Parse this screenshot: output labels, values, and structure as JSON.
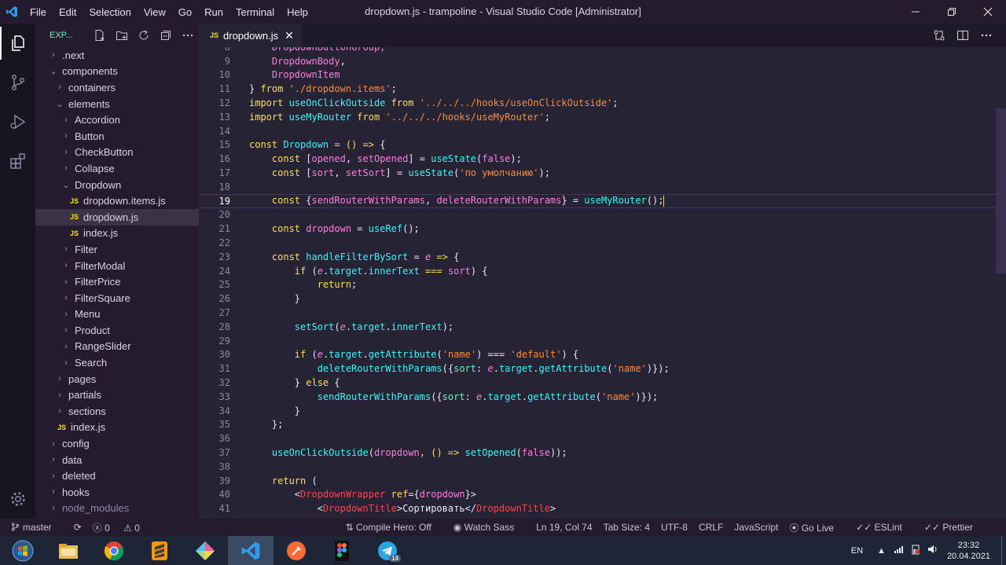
{
  "window": {
    "title": "dropdown.js - trampoline - Visual Studio Code [Administrator]"
  },
  "menu": [
    "File",
    "Edit",
    "Selection",
    "View",
    "Go",
    "Run",
    "Terminal",
    "Help"
  ],
  "sidebar": {
    "header": "EXP...",
    "tree": [
      {
        "label": ".next",
        "depth": 0,
        "type": "folder",
        "open": false
      },
      {
        "label": "components",
        "depth": 0,
        "type": "folder",
        "open": true
      },
      {
        "label": "containers",
        "depth": 1,
        "type": "folder",
        "open": false
      },
      {
        "label": "elements",
        "depth": 1,
        "type": "folder",
        "open": true
      },
      {
        "label": "Accordion",
        "depth": 2,
        "type": "folder",
        "open": false
      },
      {
        "label": "Button",
        "depth": 2,
        "type": "folder",
        "open": false
      },
      {
        "label": "CheckButton",
        "depth": 2,
        "type": "folder",
        "open": false
      },
      {
        "label": "Collapse",
        "depth": 2,
        "type": "folder",
        "open": false
      },
      {
        "label": "Dropdown",
        "depth": 2,
        "type": "folder",
        "open": true
      },
      {
        "label": "dropdown.items.js",
        "depth": 3,
        "type": "js"
      },
      {
        "label": "dropdown.js",
        "depth": 3,
        "type": "js",
        "selected": true
      },
      {
        "label": "index.js",
        "depth": 3,
        "type": "js"
      },
      {
        "label": "Filter",
        "depth": 2,
        "type": "folder",
        "open": false
      },
      {
        "label": "FilterModal",
        "depth": 2,
        "type": "folder",
        "open": false
      },
      {
        "label": "FilterPrice",
        "depth": 2,
        "type": "folder",
        "open": false
      },
      {
        "label": "FilterSquare",
        "depth": 2,
        "type": "folder",
        "open": false
      },
      {
        "label": "Menu",
        "depth": 2,
        "type": "folder",
        "open": false
      },
      {
        "label": "Product",
        "depth": 2,
        "type": "folder",
        "open": false
      },
      {
        "label": "RangeSlider",
        "depth": 2,
        "type": "folder",
        "open": false
      },
      {
        "label": "Search",
        "depth": 2,
        "type": "folder",
        "open": false
      },
      {
        "label": "pages",
        "depth": 1,
        "type": "folder",
        "open": false
      },
      {
        "label": "partials",
        "depth": 1,
        "type": "folder",
        "open": false
      },
      {
        "label": "sections",
        "depth": 1,
        "type": "folder",
        "open": false
      },
      {
        "label": "index.js",
        "depth": 1,
        "type": "js"
      },
      {
        "label": "config",
        "depth": 0,
        "type": "folder",
        "open": false
      },
      {
        "label": "data",
        "depth": 0,
        "type": "folder",
        "open": false
      },
      {
        "label": "deleted",
        "depth": 0,
        "type": "folder",
        "open": false
      },
      {
        "label": "hooks",
        "depth": 0,
        "type": "folder",
        "open": false
      },
      {
        "label": "node_modules",
        "depth": 0,
        "type": "folder",
        "open": false,
        "dim": true
      }
    ]
  },
  "tab": {
    "label": "dropdown.js",
    "icon": "JS"
  },
  "editor": {
    "current_line": 19,
    "lines": [
      {
        "n": "9",
        "t": [
          [
            "    ",
            "b"
          ],
          [
            "DropdownBody",
            "v"
          ],
          [
            ",",
            "b"
          ]
        ]
      },
      {
        "n": "10",
        "t": [
          [
            "    ",
            "b"
          ],
          [
            "DropdownItem",
            "v"
          ]
        ]
      },
      {
        "n": "11",
        "t": [
          [
            "} ",
            "b"
          ],
          [
            "from ",
            "k"
          ],
          [
            "'./dropdown.items'",
            "s"
          ],
          [
            ";",
            "b"
          ]
        ]
      },
      {
        "n": "12",
        "t": [
          [
            "import ",
            "k"
          ],
          [
            "useOnClickOutside ",
            "f"
          ],
          [
            "from ",
            "k"
          ],
          [
            "'../../../hooks/useOnClickOutside'",
            "s"
          ],
          [
            ";",
            "b"
          ]
        ]
      },
      {
        "n": "13",
        "t": [
          [
            "import ",
            "k"
          ],
          [
            "useMyRouter ",
            "f"
          ],
          [
            "from ",
            "k"
          ],
          [
            "'../../../hooks/useMyRouter'",
            "s"
          ],
          [
            ";",
            "b"
          ]
        ]
      },
      {
        "n": "14",
        "t": []
      },
      {
        "n": "15",
        "t": [
          [
            "const ",
            "k"
          ],
          [
            "Dropdown ",
            "f"
          ],
          [
            "= () => ",
            "k"
          ],
          [
            "{",
            "b"
          ]
        ]
      },
      {
        "n": "16",
        "t": [
          [
            "    const ",
            "k"
          ],
          [
            "[",
            "b"
          ],
          [
            "opened",
            "v"
          ],
          [
            ", ",
            "b"
          ],
          [
            "setOpened",
            "v"
          ],
          [
            "] = ",
            "b"
          ],
          [
            "useState",
            "f"
          ],
          [
            "(",
            "b"
          ],
          [
            "false",
            "v"
          ],
          [
            ");",
            "b"
          ]
        ]
      },
      {
        "n": "17",
        "t": [
          [
            "    const ",
            "k"
          ],
          [
            "[",
            "b"
          ],
          [
            "sort",
            "v"
          ],
          [
            ", ",
            "b"
          ],
          [
            "setSort",
            "v"
          ],
          [
            "] = ",
            "b"
          ],
          [
            "useState",
            "f"
          ],
          [
            "(",
            "b"
          ],
          [
            "'по умолчанию'",
            "s"
          ],
          [
            ");",
            "b"
          ]
        ]
      },
      {
        "n": "18",
        "t": []
      },
      {
        "n": "19",
        "t": [
          [
            "    const ",
            "k"
          ],
          [
            "{",
            "b"
          ],
          [
            "sendRouterWithParams",
            "v"
          ],
          [
            ", ",
            "b"
          ],
          [
            "deleteRouterWithParams",
            "v"
          ],
          [
            "} = ",
            "b"
          ],
          [
            "useMyRouter",
            "f"
          ],
          [
            "();",
            "b"
          ]
        ]
      },
      {
        "n": "20",
        "t": []
      },
      {
        "n": "21",
        "t": [
          [
            "    const ",
            "k"
          ],
          [
            "dropdown ",
            "v"
          ],
          [
            "= ",
            "b"
          ],
          [
            "useRef",
            "f"
          ],
          [
            "();",
            "b"
          ]
        ]
      },
      {
        "n": "22",
        "t": []
      },
      {
        "n": "23",
        "t": [
          [
            "    const ",
            "k"
          ],
          [
            "handleFilterBySort ",
            "f"
          ],
          [
            "= ",
            "b"
          ],
          [
            "e ",
            "it"
          ],
          [
            "=> ",
            "k"
          ],
          [
            "{",
            "b"
          ]
        ]
      },
      {
        "n": "24",
        "t": [
          [
            "        if ",
            "k"
          ],
          [
            "(",
            "b"
          ],
          [
            "e",
            "it"
          ],
          [
            ".",
            "b"
          ],
          [
            "target",
            "f"
          ],
          [
            ".",
            "b"
          ],
          [
            "innerText ",
            "f"
          ],
          [
            "=== ",
            "k"
          ],
          [
            "sort",
            "v"
          ],
          [
            ") {",
            "b"
          ]
        ]
      },
      {
        "n": "25",
        "t": [
          [
            "            return",
            "k"
          ],
          [
            ";",
            "b"
          ]
        ]
      },
      {
        "n": "26",
        "t": [
          [
            "        }",
            "b"
          ]
        ]
      },
      {
        "n": "27",
        "t": []
      },
      {
        "n": "28",
        "t": [
          [
            "        ",
            "b"
          ],
          [
            "setSort",
            "f"
          ],
          [
            "(",
            "b"
          ],
          [
            "e",
            "it"
          ],
          [
            ".",
            "b"
          ],
          [
            "target",
            "f"
          ],
          [
            ".",
            "b"
          ],
          [
            "innerText",
            "f"
          ],
          [
            ");",
            "b"
          ]
        ]
      },
      {
        "n": "29",
        "t": []
      },
      {
        "n": "30",
        "t": [
          [
            "        if ",
            "k"
          ],
          [
            "(",
            "b"
          ],
          [
            "e",
            "it"
          ],
          [
            ".",
            "b"
          ],
          [
            "target",
            "f"
          ],
          [
            ".",
            "b"
          ],
          [
            "getAttribute",
            "f"
          ],
          [
            "(",
            "b"
          ],
          [
            "'name'",
            "s"
          ],
          [
            ") === ",
            "b"
          ],
          [
            "'default'",
            "s"
          ],
          [
            ") {",
            "b"
          ]
        ]
      },
      {
        "n": "31",
        "t": [
          [
            "            ",
            "b"
          ],
          [
            "deleteRouterWithParams",
            "f"
          ],
          [
            "({",
            "b"
          ],
          [
            "sort",
            "t"
          ],
          [
            ": ",
            "b"
          ],
          [
            "e",
            "it"
          ],
          [
            ".",
            "b"
          ],
          [
            "target",
            "f"
          ],
          [
            ".",
            "b"
          ],
          [
            "getAttribute",
            "f"
          ],
          [
            "(",
            "b"
          ],
          [
            "'name'",
            "s"
          ],
          [
            ")});",
            "b"
          ]
        ]
      },
      {
        "n": "32",
        "t": [
          [
            "        } ",
            "b"
          ],
          [
            "else ",
            "k"
          ],
          [
            "{",
            "b"
          ]
        ]
      },
      {
        "n": "33",
        "t": [
          [
            "            ",
            "b"
          ],
          [
            "sendRouterWithParams",
            "f"
          ],
          [
            "({",
            "b"
          ],
          [
            "sort",
            "t"
          ],
          [
            ": ",
            "b"
          ],
          [
            "e",
            "it"
          ],
          [
            ".",
            "b"
          ],
          [
            "target",
            "f"
          ],
          [
            ".",
            "b"
          ],
          [
            "getAttribute",
            "f"
          ],
          [
            "(",
            "b"
          ],
          [
            "'name'",
            "s"
          ],
          [
            ")});",
            "b"
          ]
        ]
      },
      {
        "n": "34",
        "t": [
          [
            "        }",
            "b"
          ]
        ]
      },
      {
        "n": "35",
        "t": [
          [
            "    };",
            "b"
          ]
        ]
      },
      {
        "n": "36",
        "t": []
      },
      {
        "n": "37",
        "t": [
          [
            "    ",
            "b"
          ],
          [
            "useOnClickOutside",
            "f"
          ],
          [
            "(",
            "b"
          ],
          [
            "dropdown",
            "v"
          ],
          [
            ", () => ",
            "k"
          ],
          [
            "setOpened",
            "f"
          ],
          [
            "(",
            "b"
          ],
          [
            "false",
            "v"
          ],
          [
            "));",
            "b"
          ]
        ]
      },
      {
        "n": "38",
        "t": []
      },
      {
        "n": "39",
        "t": [
          [
            "    return ",
            "k"
          ],
          [
            "(",
            "b"
          ]
        ]
      },
      {
        "n": "40",
        "t": [
          [
            "        <",
            "b"
          ],
          [
            "DropdownWrapper ",
            "tag"
          ],
          [
            "ref",
            "k"
          ],
          [
            "={",
            "b"
          ],
          [
            "dropdown",
            "v"
          ],
          [
            "}>",
            "b"
          ]
        ]
      },
      {
        "n": "41",
        "t": [
          [
            "            <",
            "b"
          ],
          [
            "DropdownTitle",
            "tag"
          ],
          [
            ">Сортировать</",
            "b"
          ],
          [
            "DropdownTitle",
            "tag"
          ],
          [
            ">",
            "b"
          ]
        ]
      }
    ]
  },
  "statusbar": {
    "branch": "master",
    "errors": "0",
    "warnings": "0",
    "compile_hero": "Compile Hero: Off",
    "watch_sass": "Watch Sass",
    "cursor": "Ln 19, Col 74",
    "tab_size": "Tab Size: 4",
    "encoding": "UTF-8",
    "eol": "CRLF",
    "language": "JavaScript",
    "go_live": "Go Live",
    "eslint": "ESLint",
    "prettier": "Prettier"
  },
  "taskbar": {
    "lang": "EN",
    "time": "23:32",
    "date": "20.04.2021",
    "telegram_badge": "14"
  }
}
